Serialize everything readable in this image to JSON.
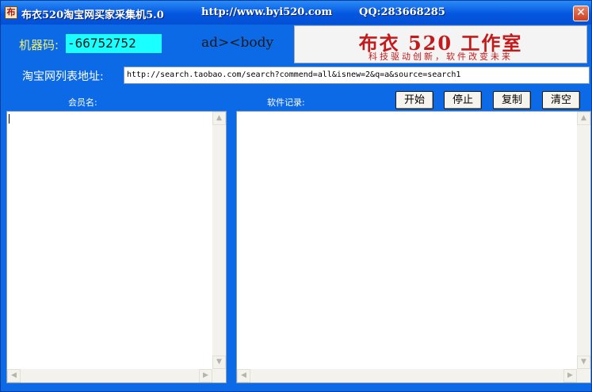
{
  "titlebar": {
    "app_name": "布衣520淘宝网买家采集机5.0",
    "url": "http://www.byi520.com",
    "qq": "QQ:283668285",
    "icon_glyph": "布",
    "close_glyph": "✕"
  },
  "machine": {
    "label": "机器码:",
    "value": "-66752752"
  },
  "ad_text": "ad><body",
  "banner": {
    "main": "布衣 520 工作室",
    "sub": "科技驱动创新，软件改变未来"
  },
  "url_field": {
    "label": "淘宝网列表地址:",
    "value": "http://search.taobao.com/search?commend=all&isnew=2&q=a&source=search1"
  },
  "members": {
    "label": "会员名:"
  },
  "log": {
    "label": "软件记录:"
  },
  "buttons": {
    "start": "开始",
    "stop": "停止",
    "copy": "复制",
    "clear": "清空"
  },
  "scroll_glyphs": {
    "up": "▲",
    "down": "▼",
    "left": "◀",
    "right": "▶"
  },
  "colors": {
    "window_bg": "#0d6ae6",
    "machine_code_bg": "#1affff",
    "banner_red": "#c41a1a",
    "label_text": "#ffffff"
  }
}
